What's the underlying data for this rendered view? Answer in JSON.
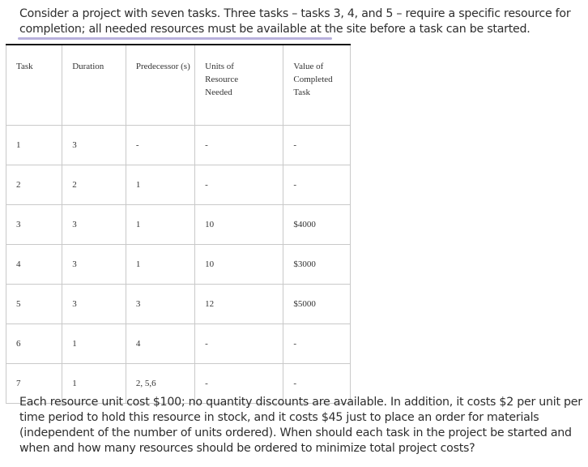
{
  "intro_text": "Consider a project with seven tasks. Three tasks – tasks 3, 4, and 5 – require a specific resource for completion; all needed resources must be available at the site before a task can be started.",
  "table": {
    "headers": [
      "Task",
      "Duration",
      "Predecessor (s)",
      "Units of Resource Needed",
      "Value of Completed Task"
    ],
    "rows": [
      [
        "1",
        "3",
        "-",
        "-",
        "-"
      ],
      [
        "2",
        "2",
        "1",
        "-",
        "-"
      ],
      [
        "3",
        "3",
        "1",
        "10",
        "$4000"
      ],
      [
        "4",
        "3",
        "1",
        "10",
        "$3000"
      ],
      [
        "5",
        "3",
        "3",
        "12",
        "$5000"
      ],
      [
        "6",
        "1",
        "4",
        "-",
        "-"
      ],
      [
        "7",
        "1",
        "2, 5,6",
        "-",
        "-"
      ]
    ]
  },
  "outro_text": "Each resource unit cost $100; no quantity discounts are available. In addition, it costs $2 per unit per time period to hold this resource in stock, and it costs $45 just to place an order for materials (independent of the number of units ordered). When should each task in the project be started and when and how many resources should be ordered to minimize total project costs?",
  "colors": {
    "highlight_underline": "#b7b0dc",
    "table_border": "#111111",
    "grid": "#c9c9c9"
  }
}
